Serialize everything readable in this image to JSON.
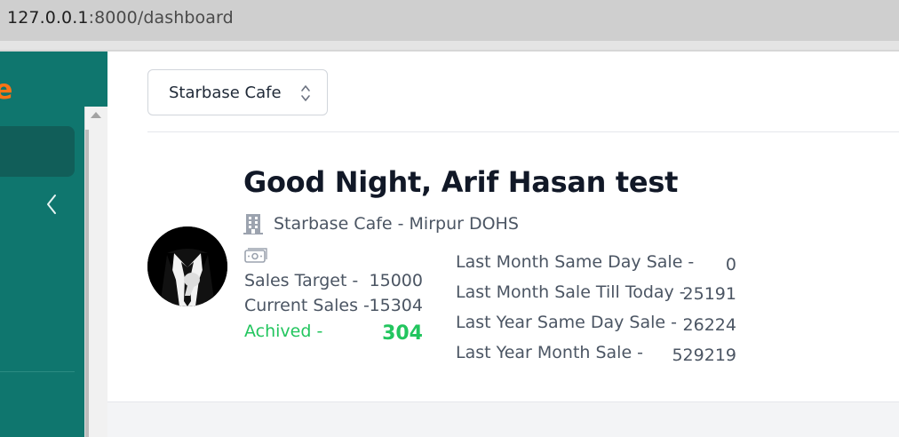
{
  "browser": {
    "url_host": "127.0.0.1",
    "url_rest": ":8000/dashboard"
  },
  "sidebar": {
    "brand_fragment": "e"
  },
  "store_selector": {
    "selected": "Starbase Cafe"
  },
  "header": {
    "greeting": "Good Night, Arif Hasan test",
    "store_location": "Starbase Cafe - Mirpur DOHS"
  },
  "sales": {
    "target_label": "Sales Target -",
    "target_value": "15000",
    "current_label": "Current Sales -",
    "current_value": "15304",
    "achieved_label": "Achived -",
    "achieved_value": "304"
  },
  "comparisons": [
    {
      "label": "Last Month Same Day Sale -",
      "value": "0"
    },
    {
      "label": "Last Month Sale Till Today -",
      "value": "25191"
    },
    {
      "label": "Last Year Same Day Sale -",
      "value": "26224"
    },
    {
      "label": "Last Year Month Sale -",
      "value": "529219"
    }
  ],
  "icons": {
    "store": "building-icon",
    "money": "banknote-icon",
    "collapse": "chevron-left-icon",
    "select": "chevron-up-down-icon"
  },
  "colors": {
    "sidebar": "#0f766e",
    "accent": "#f97316",
    "success": "#22c55e"
  }
}
